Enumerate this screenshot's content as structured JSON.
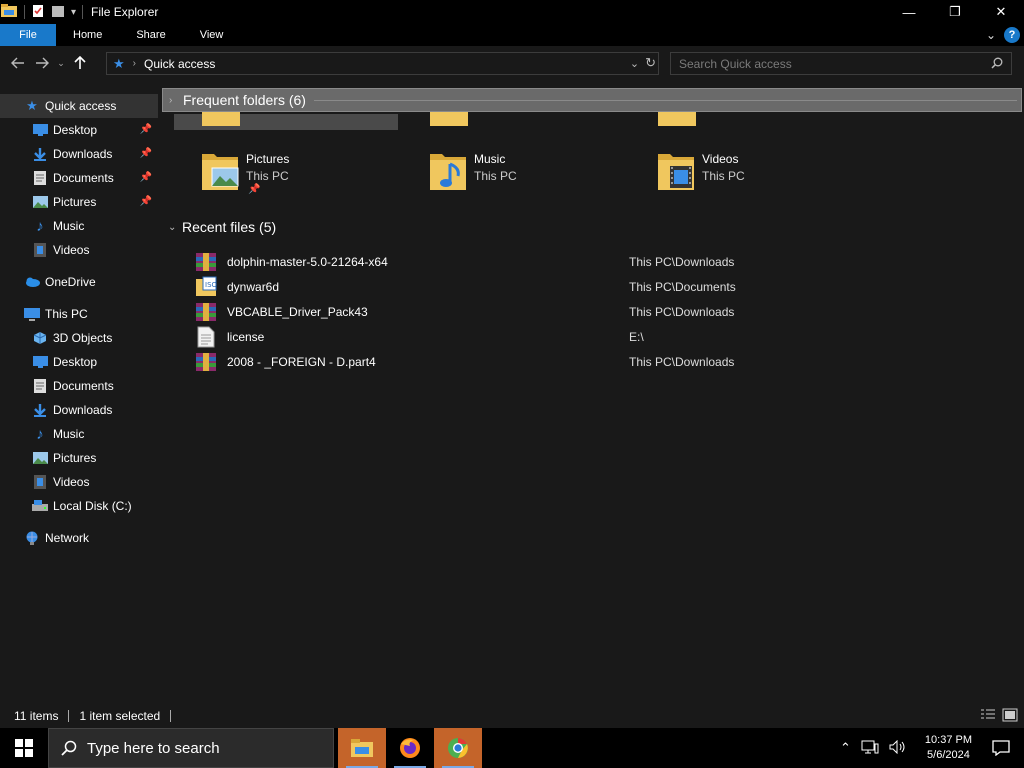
{
  "window": {
    "title": "File Explorer",
    "controls": {
      "minimize": "—",
      "maximize": "❐",
      "close": "✕"
    }
  },
  "ribbon": {
    "tabs": [
      {
        "label": "File",
        "active": true
      },
      {
        "label": "Home"
      },
      {
        "label": "Share"
      },
      {
        "label": "View"
      }
    ],
    "help": "?"
  },
  "address": {
    "breadcrumb": "Quick access",
    "search_placeholder": "Search Quick access"
  },
  "sidebar": {
    "quick_access": {
      "label": "Quick access"
    },
    "quick_items": [
      {
        "label": "Desktop",
        "icon": "desktop-icon",
        "pinned": true
      },
      {
        "label": "Downloads",
        "icon": "downloads-icon",
        "pinned": true
      },
      {
        "label": "Documents",
        "icon": "documents-icon",
        "pinned": true
      },
      {
        "label": "Pictures",
        "icon": "pictures-icon",
        "pinned": true
      },
      {
        "label": "Music",
        "icon": "music-icon",
        "pinned": false
      },
      {
        "label": "Videos",
        "icon": "videos-icon",
        "pinned": false
      }
    ],
    "onedrive": {
      "label": "OneDrive"
    },
    "thispc": {
      "label": "This PC"
    },
    "pc_items": [
      {
        "label": "3D Objects",
        "icon": "3d-objects-icon"
      },
      {
        "label": "Desktop",
        "icon": "desktop-icon"
      },
      {
        "label": "Documents",
        "icon": "documents-icon"
      },
      {
        "label": "Downloads",
        "icon": "downloads-icon"
      },
      {
        "label": "Music",
        "icon": "music-icon"
      },
      {
        "label": "Pictures",
        "icon": "pictures-icon"
      },
      {
        "label": "Videos",
        "icon": "videos-icon"
      },
      {
        "label": "Local Disk (C:)",
        "icon": "local-disk-icon"
      }
    ],
    "network": {
      "label": "Network"
    }
  },
  "content": {
    "frequent": {
      "header": "Frequent folders (6)"
    },
    "folders": [
      {
        "name": "Pictures",
        "location": "This PC",
        "icon": "pictures-folder-icon"
      },
      {
        "name": "Music",
        "location": "This PC",
        "icon": "music-folder-icon"
      },
      {
        "name": "Videos",
        "location": "This PC",
        "icon": "videos-folder-icon"
      }
    ],
    "recent": {
      "header": "Recent files (5)"
    },
    "recent_files": [
      {
        "name": "dolphin-master-5.0-21264-x64",
        "path": "This PC\\Downloads",
        "icon": "winrar-archive-icon"
      },
      {
        "name": "dynwar6d",
        "path": "This PC\\Documents",
        "icon": "iso-image-icon"
      },
      {
        "name": "VBCABLE_Driver_Pack43",
        "path": "This PC\\Downloads",
        "icon": "winrar-archive-icon"
      },
      {
        "name": "license",
        "path": "E:\\",
        "icon": "text-file-icon"
      },
      {
        "name": "2008 - _FOREIGN - D.part4",
        "path": "This PC\\Downloads",
        "icon": "winrar-archive-icon"
      }
    ]
  },
  "status": {
    "items_count": "11 items",
    "selected": "1 item selected"
  },
  "taskbar": {
    "search_placeholder": "Type here to search",
    "time": "10:37 PM",
    "date": "5/6/2024"
  },
  "colors": {
    "accent": "#1979ca",
    "window_bg": "#191919",
    "titlebar": "#000000",
    "folder_yellow": "#f0c75e",
    "taskbar_highlight": "#c4642a"
  }
}
